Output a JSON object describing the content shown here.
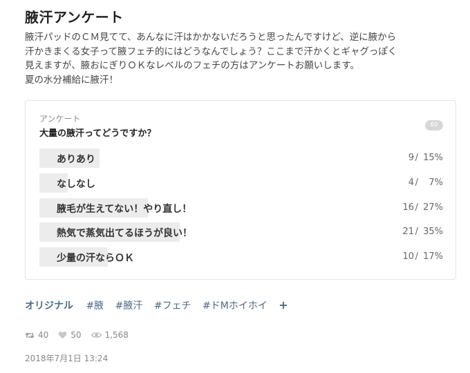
{
  "post": {
    "title": "腋汗アンケート",
    "description": [
      "腋汗パッドのＣＭ見てて、あんなに汗はかかないだろうと思ったんですけど、逆に腋から",
      "汗かきまくる女子って腋フェチ的にはどうなんでしょう？ここまで汗かくとギャグっぽく",
      "見えますが、腋おにぎりＯＫなレベルのフェチの方はアンケートお願いします。",
      "夏の水分補給に腋汗！"
    ]
  },
  "poll": {
    "label": "アンケート",
    "question": "大量の腋汗ってどうですか？",
    "total": "60",
    "options": [
      {
        "label": "ありあり",
        "count": "9",
        "percent": "15%",
        "share": 0.15
      },
      {
        "label": "なしなし",
        "count": "4",
        "percent": "7%",
        "share": 0.07
      },
      {
        "label": "腋毛が生えてない！やり直し！",
        "count": "16",
        "percent": "27%",
        "share": 0.27
      },
      {
        "label": "熱気で蒸気出てるほうが良い！",
        "count": "21",
        "percent": "35%",
        "share": 0.35
      },
      {
        "label": "少量の汗ならＯＫ",
        "count": "10",
        "percent": "17%",
        "share": 0.17
      }
    ]
  },
  "tags": {
    "original": "オリジナル",
    "items": [
      "#腋",
      "#腋汗",
      "#フェチ",
      "#ドMホイホイ"
    ],
    "add": "+"
  },
  "stats": {
    "retweets": "40",
    "likes": "50",
    "views": "1,568"
  },
  "date": "2018年7月1日 13:24",
  "colors": {
    "bar": "#ececec",
    "tag": "#4a6a86",
    "badge": "#d7d7d7"
  }
}
